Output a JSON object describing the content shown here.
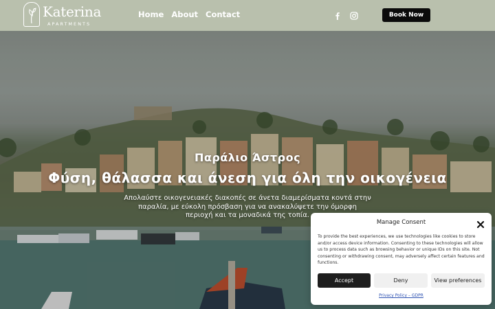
{
  "brand": {
    "name": "Katerina",
    "sub": "APARTMENTS"
  },
  "nav": {
    "items": [
      {
        "label": "Home"
      },
      {
        "label": "About"
      },
      {
        "label": "Contact"
      }
    ]
  },
  "social": {
    "icons": [
      "facebook-icon",
      "instagram-icon"
    ]
  },
  "header": {
    "book_label": "Book Now"
  },
  "hero": {
    "eyebrow": "Παράλιο Άστρος",
    "title": "Φύση, θάλασσα και άνεση για όλη την οικογένεια",
    "description": "Απολαύστε οικογενειακές διακοπές σε άνετα διαμερίσματα κοντά στην παραλία, με εύκολη πρόσβαση για να ανακαλύψετε την όμορφη περιοχή και τα μοναδικά της τοπία."
  },
  "consent": {
    "title": "Manage Consent",
    "body": "To provide the best experiences, we use technologies like cookies to store and/or access device information. Consenting to these technologies will allow us to process data such as browsing behavior or unique IDs on this site. Not consenting or withdrawing consent, may adversely affect certain features and functions.",
    "accept_label": "Accept",
    "deny_label": "Deny",
    "prefs_label": "View preferences",
    "policy_link": "Privacy Policy – GDPR"
  },
  "colors": {
    "header_bg": "#b9c0ad",
    "button_dark": "#0b0b0b",
    "link_blue": "#2a4fb0"
  }
}
